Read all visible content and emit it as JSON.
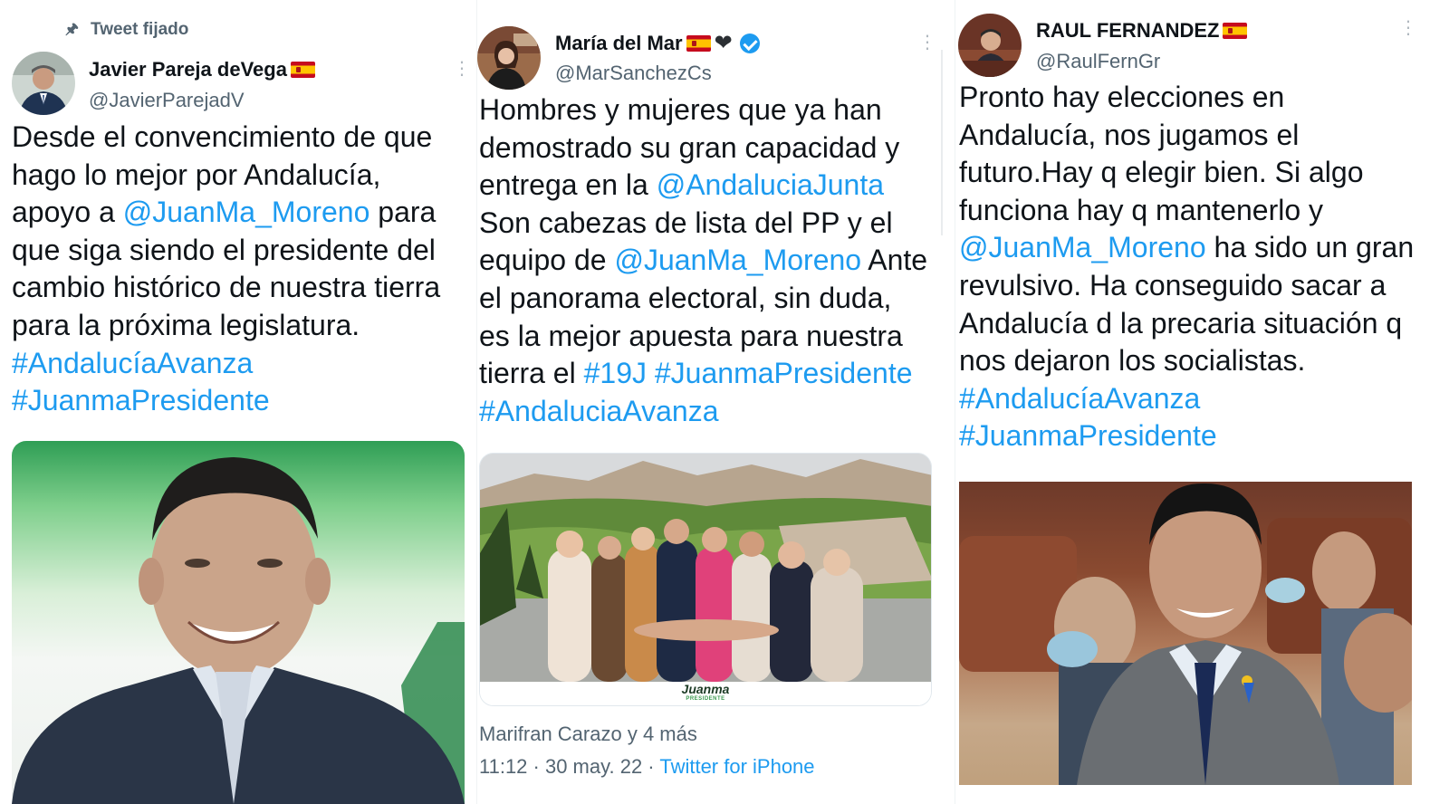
{
  "tweets": [
    {
      "pinned_label": "Tweet fijado",
      "display_name": "Javier Pareja deVega",
      "handle": "@JavierParejadV",
      "text_lines": [
        [
          "Desde el convencimiento de que",
          ""
        ],
        [
          "hago lo mejor por Andalucía,",
          ""
        ],
        [
          "apoyo a ",
          "@JuanMa_Moreno",
          " para"
        ],
        [
          "que siga siendo el presidente del",
          ""
        ],
        [
          "cambio histórico de nuestra tierra",
          ""
        ],
        [
          "para la próxima legislatura.",
          ""
        ],
        [
          "",
          "#AndalucíaAvanza"
        ],
        [
          "",
          "#JuanmaPresidente"
        ]
      ],
      "media_alt": "photo-juanma-moreno-smiling"
    },
    {
      "display_name": "María del Mar",
      "handle": "@MarSanchezCs",
      "text_lines": [
        [
          "Hombres y mujeres que ya han",
          ""
        ],
        [
          "demostrado su gran capacidad y",
          ""
        ],
        [
          "entrega en la ",
          "@AndaluciaJunta"
        ],
        [
          "Son cabezas de lista del PP y el",
          ""
        ],
        [
          "equipo de ",
          "@JuanMa_Moreno",
          " Ante"
        ],
        [
          "el panorama electoral, sin duda,",
          ""
        ],
        [
          "es la mejor apuesta para nuestra",
          ""
        ],
        [
          "tierra el ",
          "#19J #JuanmaPresidente"
        ],
        [
          "",
          "#AndaluciaAvanza"
        ]
      ],
      "media_caption": "Juanma",
      "media_subcaption": "PRESIDENTE",
      "liked_by": "Marifran Carazo y 4 más",
      "timestamp": "11:12 · 30 may. 22 · ",
      "source": "Twitter for iPhone"
    },
    {
      "display_name": "RAUL FERNANDEZ",
      "handle": "@RaulFernGr",
      "text_lines": [
        [
          "Pronto hay elecciones en",
          ""
        ],
        [
          "Andalucía, nos jugamos el",
          ""
        ],
        [
          "futuro.Hay q elegir bien. Si algo",
          ""
        ],
        [
          "funciona hay q mantenerlo y",
          ""
        ],
        [
          "",
          "@JuanMa_Moreno",
          " ha sido un gran"
        ],
        [
          "revulsivo. Ha conseguido sacar a",
          ""
        ],
        [
          "Andalucía d la precaria situación q",
          ""
        ],
        [
          "nos dejaron los socialistas.",
          ""
        ],
        [
          "",
          "#AndalucíaAvanza"
        ],
        [
          "",
          "#JuanmaPresidente"
        ]
      ],
      "media_alt": "photo-juanma-moreno-parliament"
    }
  ],
  "colors": {
    "link": "#1d9bf0",
    "secondary_text": "#536471",
    "primary_text": "#0f1419",
    "verified": "#1d9bf0"
  },
  "icons": [
    "pin-icon",
    "more-icon",
    "spain-flag-icon",
    "black-heart-icon",
    "verified-badge-icon"
  ]
}
